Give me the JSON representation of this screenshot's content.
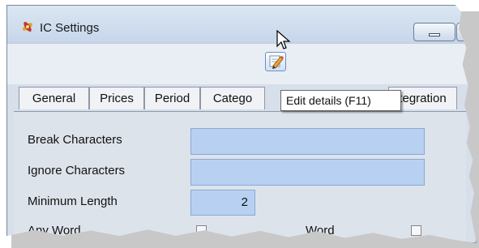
{
  "window": {
    "title": "IC Settings"
  },
  "toolbar": {
    "edit_button_icon": "pencil-edit-icon",
    "tooltip": "Edit details (F11)"
  },
  "tabs": [
    {
      "label": "General"
    },
    {
      "label": "Prices"
    },
    {
      "label": "Period"
    },
    {
      "label": "Catego"
    },
    {
      "label": "tegration"
    }
  ],
  "form": {
    "break_characters_label": "Break Characters",
    "break_characters_value": "",
    "ignore_characters_label": "Ignore Characters",
    "ignore_characters_value": "",
    "minimum_length_label": "Minimum Length",
    "minimum_length_value": "2",
    "any_word_label": "Any Word",
    "word_label": "Word"
  },
  "colors": {
    "field_bg": "#b8d1f3",
    "titlebar": "#c6d6ea"
  }
}
